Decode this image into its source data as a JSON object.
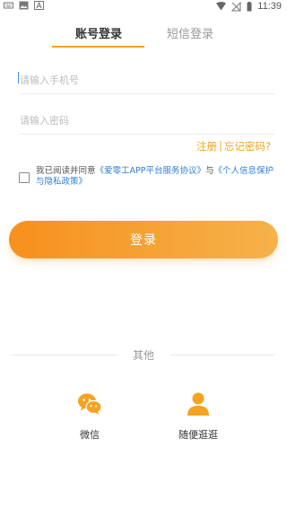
{
  "status_bar": {
    "time": "11:39"
  },
  "tabs": {
    "account_login": "账号登录",
    "sms_login": "短信登录"
  },
  "form": {
    "phone_placeholder": "请输入手机号",
    "password_placeholder": "请输入密码"
  },
  "links": {
    "register": "注册",
    "separator": "|",
    "forgot": "忘记密码?"
  },
  "agreement": {
    "prefix": "我已阅读并同意",
    "service": "《爱零工APP平台服务协议》",
    "and": "与",
    "privacy": "《个人信息保护与隐私政策》"
  },
  "login_button": "登录",
  "other": {
    "title": "其他",
    "wechat": "微信",
    "browse": "随便逛逛"
  },
  "colors": {
    "accent": "#f6a321",
    "link_blue": "#2f7fd8"
  }
}
